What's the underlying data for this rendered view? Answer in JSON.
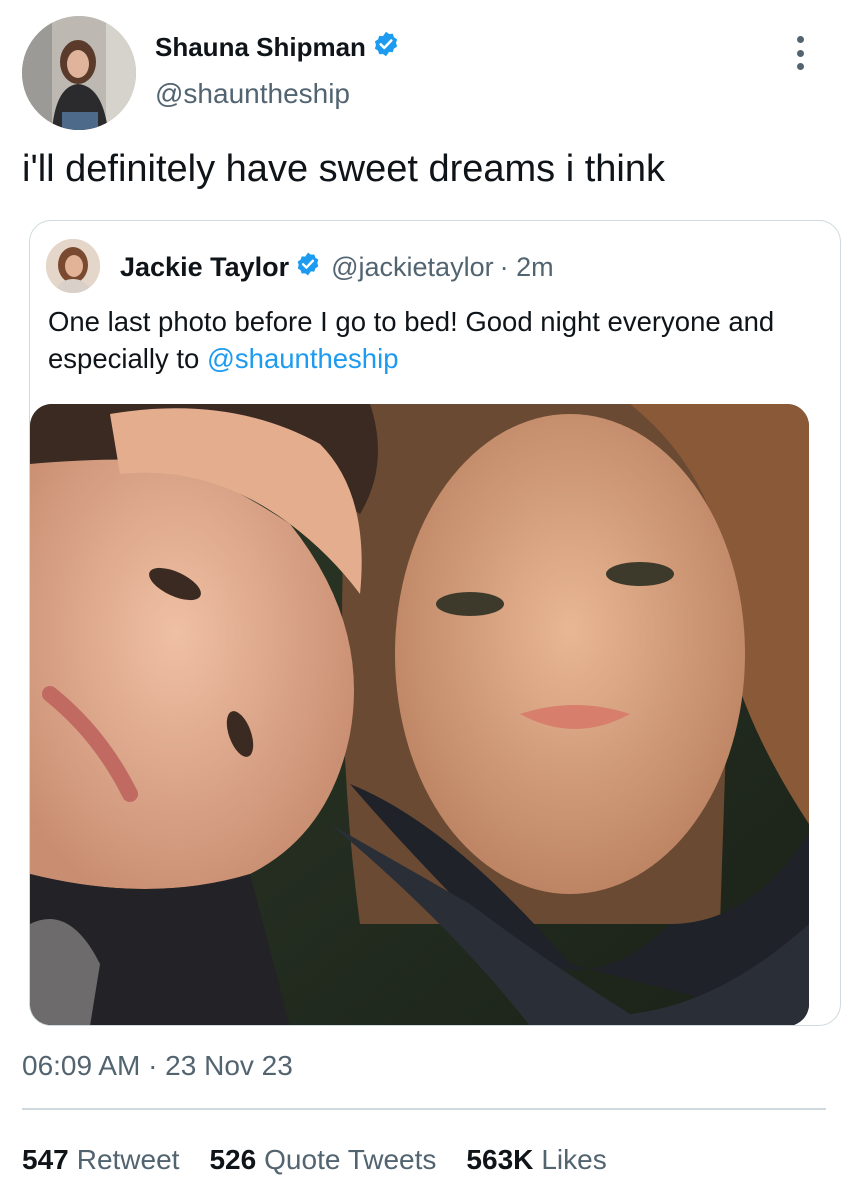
{
  "author": {
    "name": "Shauna Shipman",
    "handle": "@shauntheship",
    "verified_icon": "verified-badge-icon"
  },
  "tweet": {
    "text": "i'll definitely have sweet dreams i think"
  },
  "quoted_tweet": {
    "name": "Jackie Taylor",
    "handle": "@jackietaylor",
    "time": "· 2m",
    "text": "One last photo before I go to bed! Good night everyone and especially to ",
    "mention": "@shauntheship"
  },
  "timestamp": "06:09 AM · 23 Nov 23",
  "stats": {
    "retweets_count": "547",
    "retweets_label": "Retweet",
    "quotes_count": "526",
    "quotes_label": "Quote Tweets",
    "likes_count": "563K",
    "likes_label": "Likes"
  },
  "colors": {
    "accent": "#1d9bf0",
    "muted": "#536471",
    "text": "#0f1419",
    "border": "#cfd9de"
  }
}
